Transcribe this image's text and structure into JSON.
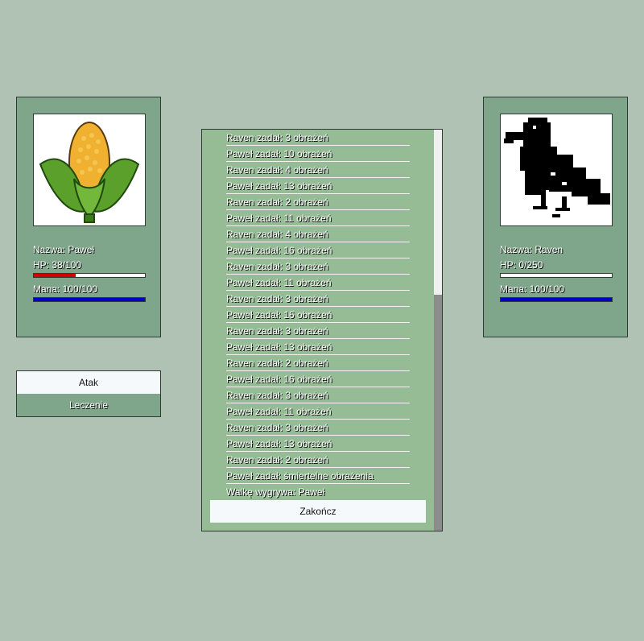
{
  "player": {
    "name_label": "Nazwa: Paweł",
    "hp_label": "HP: 38/100",
    "hp_fraction": 0.38,
    "mana_label": "Mana: 100/100",
    "mana_fraction": 1.0,
    "portrait_icon": "corn-icon"
  },
  "enemy": {
    "name_label": "Nazwa: Raven",
    "hp_label": "HP: 0/250",
    "hp_fraction": 0.0,
    "mana_label": "Mana: 100/100",
    "mana_fraction": 1.0,
    "portrait_icon": "raven-icon"
  },
  "actions": {
    "attack_label": "Atak",
    "heal_label": "Leczenie"
  },
  "battle_log": {
    "entries": [
      "Raven zadał: 3 obrażeń",
      "Paweł zadał: 10 obrażeń",
      "Raven zadał: 4 obrażeń",
      "Paweł zadał: 13 obrażeń",
      "Raven zadał: 2 obrażeń",
      "Paweł zadał: 11 obrażeń",
      "Raven zadał: 4 obrażeń",
      "Paweł zadał: 16 obrażeń",
      "Raven zadał: 3 obrażeń",
      "Paweł zadał: 11 obrażeń",
      "Raven zadał: 3 obrażeń",
      "Paweł zadał: 16 obrażeń",
      "Raven zadał: 3 obrażeń",
      "Paweł zadał: 13 obrażeń",
      "Raven zadał: 2 obrażeń",
      "Paweł zadał: 16 obrażeń",
      "Raven zadał: 3 obrażeń",
      "Paweł zadał: 11 obrażeń",
      "Raven zadał: 3 obrażeń",
      "Paweł zadał: 13 obrażeń",
      "Raven zadał: 2 obrażeń",
      "Paweł zadał: śmiertelne obrażenia",
      "Walkę wygrywa: Paweł"
    ],
    "end_button_label": "Zakończ"
  },
  "colors": {
    "hp_fill": "#d40000",
    "mana_fill": "#0000cc",
    "panel_bg": "#7fa68a",
    "log_bg": "#96bc96",
    "page_bg": "#b0c2b4"
  }
}
